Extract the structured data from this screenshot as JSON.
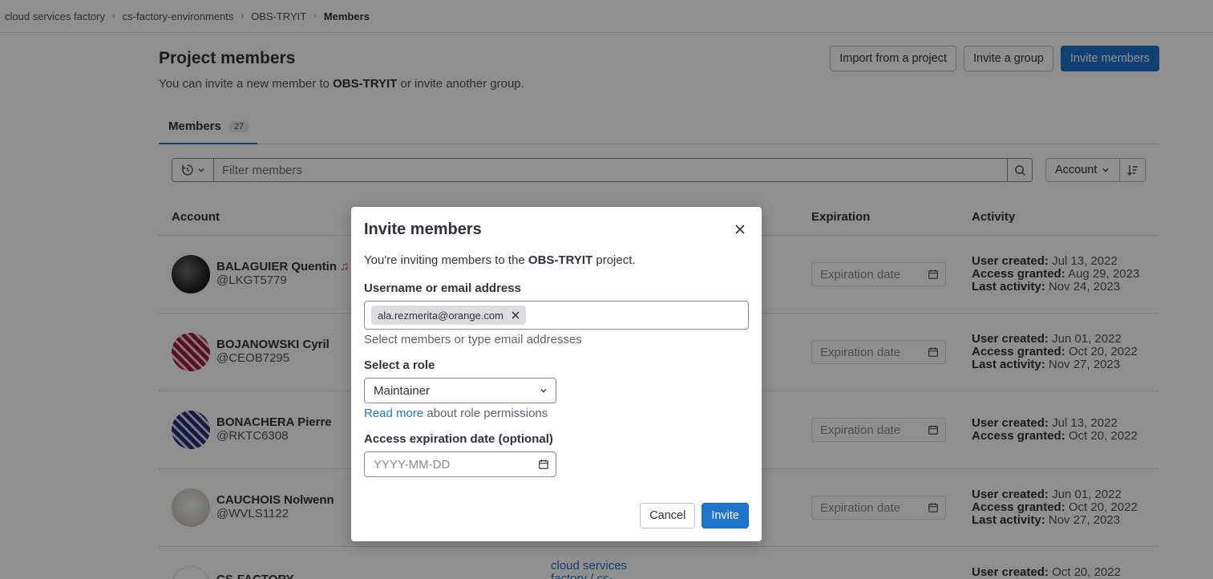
{
  "breadcrumb": {
    "items": [
      "cloud services factory",
      "cs-factory-environments",
      "OBS-TRYIT"
    ],
    "current": "Members"
  },
  "header": {
    "title": "Project members",
    "desc_prefix": "You can invite a new member to ",
    "desc_project": "OBS-TRYIT",
    "desc_suffix": " or invite another group.",
    "import_label": "Import from a project",
    "invite_group_label": "Invite a group",
    "invite_members_label": "Invite members"
  },
  "tabs": [
    {
      "label": "Members",
      "count": "27"
    }
  ],
  "filter": {
    "placeholder": "Filter members",
    "sort_label": "Account"
  },
  "table": {
    "headers": {
      "account": "Account",
      "expiration": "Expiration",
      "activity": "Activity"
    },
    "rows": [
      {
        "name": "BALAGUIER Quentin",
        "handle": "@LKGT5779",
        "expiration_placeholder": "Expiration date",
        "activity": [
          {
            "label": "User created:",
            "value": "Jul 13, 2022"
          },
          {
            "label": "Access granted:",
            "value": "Aug 29, 2023"
          },
          {
            "label": "Last activity:",
            "value": "Nov 24, 2023"
          }
        ]
      },
      {
        "name": "BOJANOWSKI Cyril",
        "handle": "@CEOB7295",
        "expiration_placeholder": "Expiration date",
        "activity": [
          {
            "label": "User created:",
            "value": "Jun 01, 2022"
          },
          {
            "label": "Access granted:",
            "value": "Oct 20, 2022"
          },
          {
            "label": "Last activity:",
            "value": "Nov 27, 2023"
          }
        ]
      },
      {
        "name": "BONACHERA Pierre",
        "handle": "@RKTC6308",
        "expiration_placeholder": "Expiration date",
        "activity": [
          {
            "label": "User created:",
            "value": "Jul 13, 2022"
          },
          {
            "label": "Access granted:",
            "value": "Oct 20, 2022"
          }
        ]
      },
      {
        "name": "CAUCHOIS Nolwenn",
        "handle": "@WVLS1122",
        "expiration_placeholder": "Expiration date",
        "activity": [
          {
            "label": "User created:",
            "value": "Jun 01, 2022"
          },
          {
            "label": "Access granted:",
            "value": "Oct 20, 2022"
          },
          {
            "label": "Last activity:",
            "value": "Nov 27, 2023"
          }
        ]
      },
      {
        "name": "CS-FACTORY",
        "handle": "",
        "group_lines": [
          "cloud services",
          "factory / cs-"
        ],
        "activity": [
          {
            "label": "User created:",
            "value": "Oct 20, 2022"
          }
        ]
      }
    ]
  },
  "modal": {
    "title": "Invite members",
    "intro_prefix": "You're inviting members to the ",
    "intro_project": "OBS-TRYIT",
    "intro_suffix": " project.",
    "username_label": "Username or email address",
    "token": "ala.rezmerita@orange.com",
    "username_help": "Select members or type email addresses",
    "role_label": "Select a role",
    "role_value": "Maintainer",
    "read_more": "Read more",
    "role_help_suffix": " about role permissions",
    "expiration_label": "Access expiration date (optional)",
    "date_placeholder": "YYYY-MM-DD",
    "cancel_label": "Cancel",
    "invite_label": "Invite"
  },
  "colors": {
    "primary": "#1f75cb",
    "overlay": "rgba(0,0,0,0.44)"
  }
}
